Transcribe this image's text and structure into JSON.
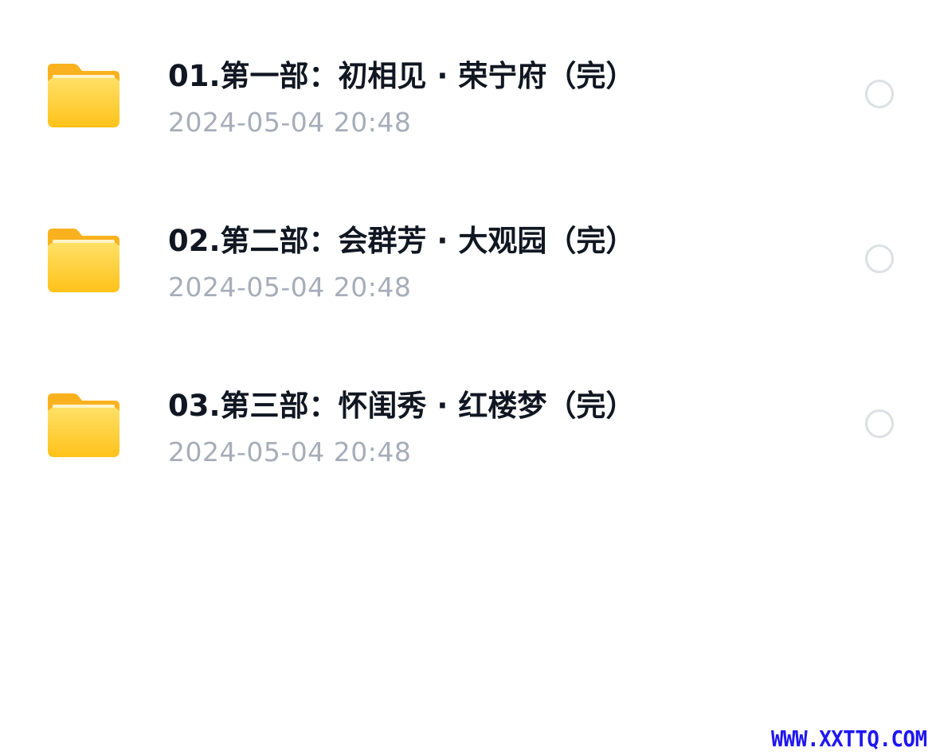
{
  "file_list": {
    "items": [
      {
        "name": "01.第一部：初相见 · 荣宁府（完）",
        "modified": "2024-05-04 20:48",
        "icon": "folder-icon",
        "selected": false
      },
      {
        "name": "02.第二部：会群芳 · 大观园（完）",
        "modified": "2024-05-04 20:48",
        "icon": "folder-icon",
        "selected": false
      },
      {
        "name": "03.第三部：怀闺秀 · 红楼梦（完）",
        "modified": "2024-05-04 20:48",
        "icon": "folder-icon",
        "selected": false
      }
    ]
  },
  "colors": {
    "folder_yellow": "#FFC93A",
    "folder_tab": "#F9B21E",
    "title_text": "#111722",
    "time_text": "#A7ADB9",
    "radio_border": "#DCDFE4",
    "watermark": "#1F16F2"
  },
  "watermark": {
    "text": "WWW.XXTTQ.COM"
  }
}
